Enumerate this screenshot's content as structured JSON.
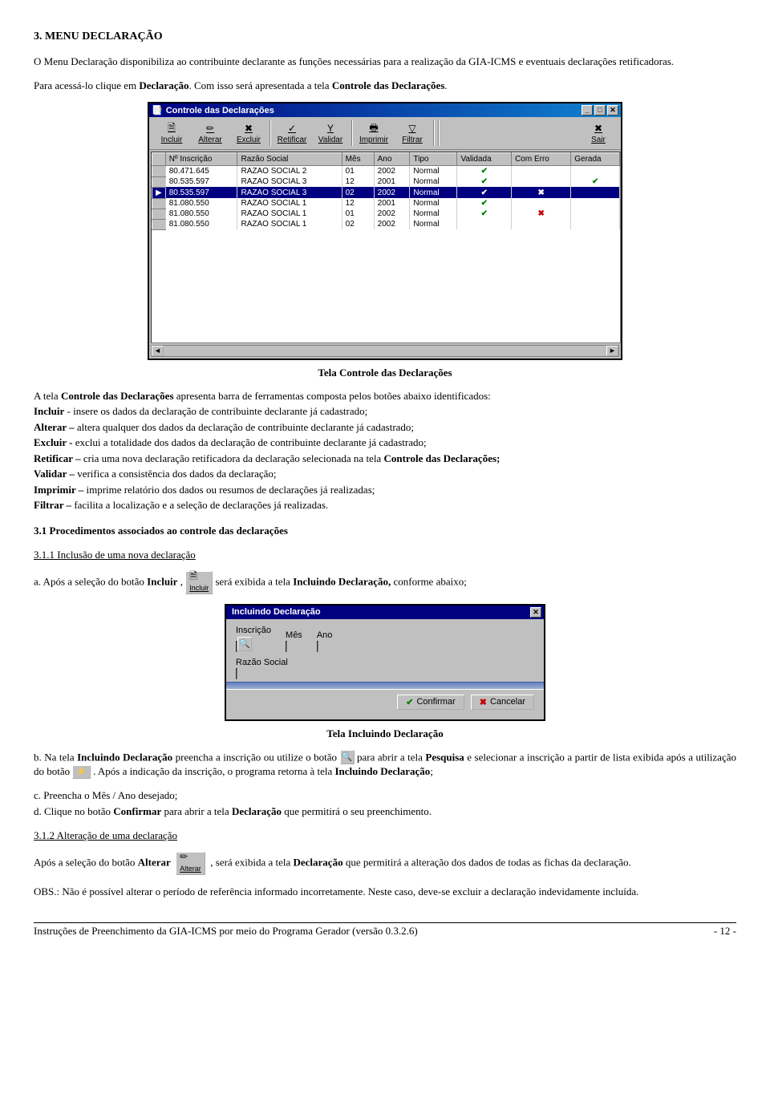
{
  "heading": "3. MENU DECLARAÇÃO",
  "intro": "O Menu Declaração disponibiliza ao contribuinte declarante as funções necessárias para a realização da GIA-ICMS e eventuais declarações retificadoras.",
  "access": {
    "pre": "Para acessá-lo clique em ",
    "bold1": "Declaração",
    "mid": ". Com isso será apresentada a tela ",
    "bold2": "Controle das Declarações",
    "post": "."
  },
  "win1": {
    "title": "Controle das Declarações",
    "toolbar": [
      "Incluir",
      "Alterar",
      "Excluir",
      "Retificar",
      "Validar",
      "Imprimir",
      "Filtrar",
      "Sair"
    ],
    "toolbar_icons": [
      "🗎",
      "✏",
      "✖",
      "✓",
      "Y",
      "🖶",
      "▽",
      "✖"
    ],
    "cols": [
      "Nº Inscrição",
      "Razão Social",
      "Mês",
      "Ano",
      "Tipo",
      "Validada",
      "Com Erro",
      "Gerada"
    ],
    "rows": [
      {
        "insc": "80.471.645",
        "rz": "RAZAO SOCIAL 2",
        "mes": "01",
        "ano": "2002",
        "tipo": "Normal",
        "v": "✔",
        "e": "",
        "g": "",
        "sel": false
      },
      {
        "insc": "80.535.597",
        "rz": "RAZAO SOCIAL 3",
        "mes": "12",
        "ano": "2001",
        "tipo": "Normal",
        "v": "✔",
        "e": "",
        "g": "✔",
        "sel": false
      },
      {
        "insc": "80.535.597",
        "rz": "RAZAO SOCIAL 3",
        "mes": "02",
        "ano": "2002",
        "tipo": "Normal",
        "v": "✔",
        "e": "✖",
        "g": "",
        "sel": true
      },
      {
        "insc": "81.080.550",
        "rz": "RAZAO SOCIAL 1",
        "mes": "12",
        "ano": "2001",
        "tipo": "Normal",
        "v": "✔",
        "e": "",
        "g": "",
        "sel": false
      },
      {
        "insc": "81.080.550",
        "rz": "RAZAO SOCIAL 1",
        "mes": "01",
        "ano": "2002",
        "tipo": "Normal",
        "v": "✔",
        "e": "✖",
        "g": "",
        "sel": false
      },
      {
        "insc": "81.080.550",
        "rz": "RAZAO SOCIAL 1",
        "mes": "02",
        "ano": "2002",
        "tipo": "Normal",
        "v": "",
        "e": "",
        "g": "",
        "sel": false
      }
    ]
  },
  "caption1": "Tela Controle das Declarações",
  "desc": {
    "lead_a": "A tela ",
    "lead_b": "Controle das Declarações",
    "lead_c": " apresenta barra de ferramentas composta pelos botões abaixo identificados:",
    "items": [
      {
        "b": "Incluir",
        "t": " - insere os dados da declaração de contribuinte declarante já cadastrado;"
      },
      {
        "b": "Alterar –",
        "t": " altera qualquer dos dados da declaração de contribuinte declarante já cadastrado;"
      },
      {
        "b": "Excluir -",
        "t": " exclui a totalidade dos dados da declaração de contribuinte declarante já cadastrado;"
      },
      {
        "b": "Retificar –",
        "t": " cria uma nova declaração retificadora da declaração selecionada na tela ",
        "b2": "Controle das Declarações;"
      },
      {
        "b": "Validar –",
        "t": " verifica a consistência dos dados da declaração;"
      },
      {
        "b": "Imprimir –",
        "t": " imprime relatório dos dados ou resumos de declarações já realizadas;"
      },
      {
        "b": "Filtrar –",
        "t": " facilita a localização e a seleção de declarações já realizadas."
      }
    ]
  },
  "sec31": "3.1 Procedimentos associados ao controle das declarações",
  "sec311": "3.1.1 Inclusão de uma nova declaração",
  "stepA": {
    "pre": "a. Após a seleção do botão ",
    "bold": "Incluir",
    "comma": " , ",
    "icon_lbl": "Incluir",
    "post_pre": " será exibida a tela ",
    "post_b": "Incluindo Declaração,",
    "post": " conforme abaixo;"
  },
  "dlg": {
    "title": "Incluindo Declaração",
    "labels": {
      "insc": "Inscrição",
      "mes": "Mês",
      "ano": "Ano",
      "rz": "Razão Social"
    },
    "btn_ok": "Confirmar",
    "btn_cancel": "Cancelar"
  },
  "caption2": "Tela Incluindo Declaração",
  "stepB": {
    "a": "b. Na tela ",
    "b": "Incluindo Declaração",
    "c": " preencha a inscrição ou utilize o botão ",
    "d": " para abrir a tela ",
    "e": "Pesquisa",
    "f": " e selecionar a inscrição a partir de lista exibida após a utilização do botão ",
    "g": ". Após a indicação da inscrição, o programa retorna à tela ",
    "h": "Incluindo Declaração",
    "i": ";"
  },
  "stepC": "c. Preencha o Mês / Ano desejado;",
  "stepD": {
    "a": "d. Clique no botão ",
    "b": "Confirmar",
    "c": " para abrir a tela ",
    "d": "Declaração",
    "e": " que permitirá o seu preenchimento."
  },
  "sec312": "3.1.2 Alteração de uma declaração",
  "alt": {
    "a": "Após a seleção do botão ",
    "b": "Alterar",
    "icon_lbl": "Alterar",
    "c": ", será exibida a tela ",
    "d": "Declaração",
    "e": " que permitirá a alteração dos dados de todas as fichas da declaração."
  },
  "obs": "OBS.: Não é possível alterar o período de referência informado incorretamente. Neste caso, deve-se excluir a declaração indevidamente incluída.",
  "footer": {
    "left": "Instruções de Preenchimento da GIA-ICMS por meio do Programa Gerador (versão 0.3.2.6)",
    "right": "- 12 -"
  }
}
